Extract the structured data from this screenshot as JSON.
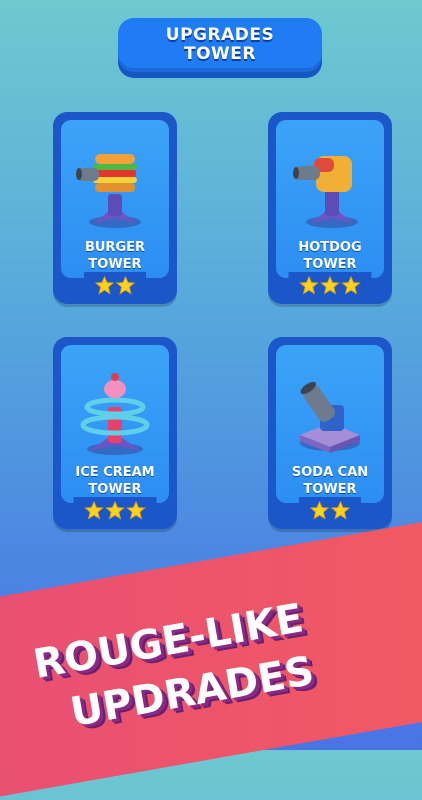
{
  "header": {
    "line1": "UPGRADES",
    "line2": "TOWER"
  },
  "cards": [
    {
      "line1": "BURGER",
      "line2": "TOWER",
      "stars": 2,
      "icon": "burger-tower-icon"
    },
    {
      "line1": "HOTDOG",
      "line2": "TOWER",
      "stars": 3,
      "icon": "hotdog-tower-icon"
    },
    {
      "line1": "ICE CREAM",
      "line2": "TOWER",
      "stars": 3,
      "icon": "ice-cream-tower-icon"
    },
    {
      "line1": "SODA CAN",
      "line2": "TOWER",
      "stars": 2,
      "icon": "soda-can-tower-icon"
    }
  ],
  "banner": {
    "line1": "ROUGE-LIKE",
    "line2": "UPDRADES"
  },
  "colors": {
    "star": "#ffd21e",
    "card": "#1b57c9",
    "banner": "#ee5468"
  }
}
